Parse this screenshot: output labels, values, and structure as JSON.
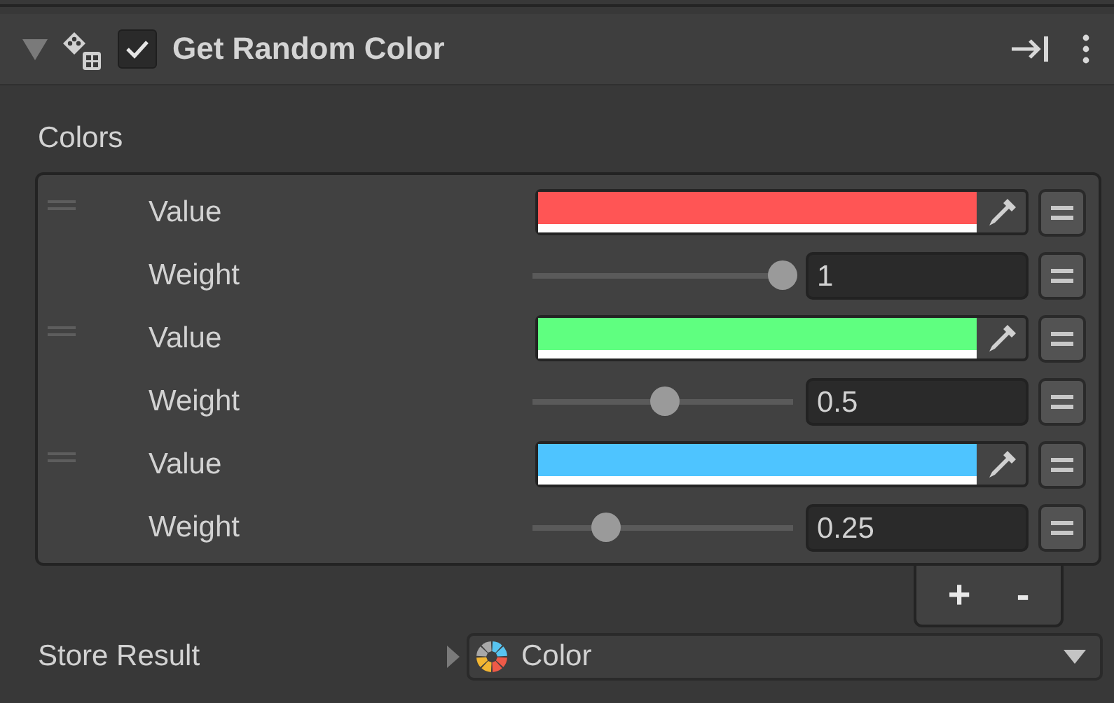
{
  "component": {
    "title": "Get Random Color",
    "expanded": true,
    "enabled": true
  },
  "colors": {
    "label": "Colors",
    "items": [
      {
        "value_label": "Value",
        "color": "#ff5555",
        "weight_label": "Weight",
        "weight": "1",
        "level": 1
      },
      {
        "value_label": "Value",
        "color": "#5fff80",
        "weight_label": "Weight",
        "weight": "0.5",
        "level": 0.5
      },
      {
        "value_label": "Value",
        "color": "#4ec4ff",
        "weight_label": "Weight",
        "weight": "0.25",
        "level": 0.25
      }
    ],
    "add": "+",
    "remove": "-"
  },
  "store_result": {
    "label": "Store Result",
    "expanded": false,
    "value": "Color"
  }
}
